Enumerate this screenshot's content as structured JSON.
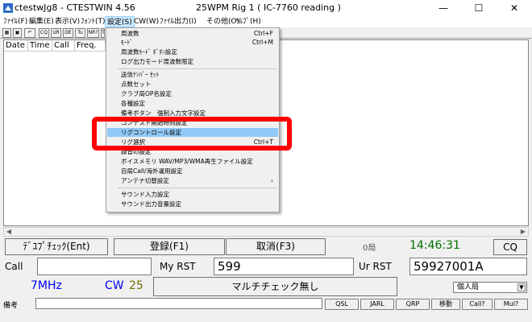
{
  "window": {
    "title": "ctestwJg8   - CTESTWIN  4.56",
    "status_title": "25WPM  Rig 1 ( IC-7760 reading )",
    "controls": {
      "minimize": "—",
      "maximize": "☐",
      "close": "✕"
    }
  },
  "menubar": [
    "ﾌｧｲﾙ(F)",
    "編集(E)",
    "表示(V)",
    "ﾌｫﾝﾄ(T)",
    "設定(S)",
    "CW(W)",
    "ﾌｧｲﾙ出力(I)",
    "その他(O)",
    "ﾍﾙﾌﾟ(H)"
  ],
  "toolbar": [
    "CQ",
    "UR",
    "DE",
    "Tu",
    "NR?",
    "T"
  ],
  "log_grid": {
    "columns": [
      "Date",
      "Time",
      "Call",
      "Freq."
    ]
  },
  "settings_menu": {
    "items": [
      {
        "label": "周波数",
        "shortcut": "Ctrl+F"
      },
      {
        "label": "ﾓｰﾄﾞ",
        "shortcut": "Ctrl+M"
      },
      {
        "label": "周波数ﾓｰﾄﾞ ﾎﾞﾀﾝ設定",
        "shortcut": ""
      },
      {
        "label": "ログ出力モード周波数限定",
        "shortcut": ""
      },
      {
        "label": "送信ﾅﾝﾊﾞｰ ｾｯﾄ",
        "shortcut": ""
      },
      {
        "label": "点数セット",
        "shortcut": ""
      },
      {
        "label": "クラブ局OP名設定",
        "shortcut": ""
      },
      {
        "label": "各種設定",
        "shortcut": ""
      },
      {
        "label": "備考ボタン　強制入力文字設定",
        "shortcut": ""
      },
      {
        "label": "コンテスト開始時刻設定",
        "shortcut": ""
      },
      {
        "label": "リグコントロール設定",
        "shortcut": ""
      },
      {
        "label": "リグ選択",
        "shortcut": "Ctrl+T"
      },
      {
        "label": "録音の設定",
        "shortcut": ""
      },
      {
        "label": "ボイスメモリ WAV/MP3/WMA再生ファイル設定",
        "shortcut": ""
      },
      {
        "label": "自局Call/海外運用設定",
        "shortcut": ""
      },
      {
        "label": "アンテナ切替設定",
        "shortcut": ""
      },
      {
        "label": "サウンド入力設定",
        "shortcut": ""
      },
      {
        "label": "サウンド出力音量設定",
        "shortcut": ""
      }
    ],
    "highlighted": "リグコントロール設定"
  },
  "entry": {
    "dupe_check": "ﾃﾞﾕﾌﾟﾁｪｯｸ(Ent)",
    "log": "登録(F1)",
    "cancel": "取消(F3)",
    "qso_count": "0局",
    "time": "14:46:31",
    "cq": "CQ",
    "call_label": "Call",
    "call_value": "",
    "my_rst_label": "My RST",
    "my_rst_value": "599",
    "ur_rst_label": "Ur RST",
    "ur_rst_value": "59927001A",
    "band": "7MHz",
    "mode": "CW",
    "mode_num": "25",
    "multi_status": "マルチチェック無し",
    "station_type": "個人局",
    "remarks_label": "備考",
    "remarks_value": "",
    "buttons": [
      "QSL",
      "JARL",
      "QRP",
      "移動",
      "Call?",
      "Mul?"
    ]
  },
  "colors": {
    "time": "#007000",
    "band": "#0000ff",
    "mode": "#0000ff",
    "mode_num": "#707000",
    "highlight": "#91c9f7",
    "annotation": "#ff0000"
  }
}
